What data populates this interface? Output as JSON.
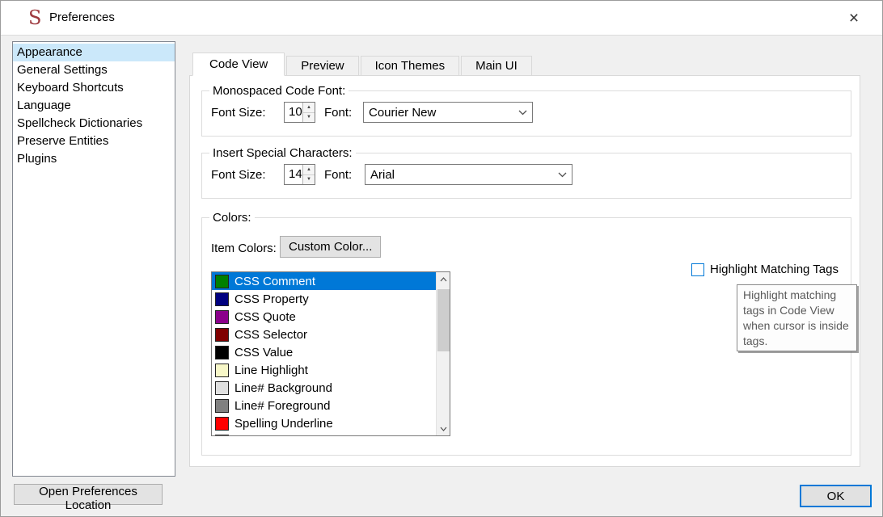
{
  "window": {
    "title": "Preferences",
    "logo_glyph": "S",
    "close_glyph": "×"
  },
  "sidebar": {
    "items": [
      {
        "label": "Appearance",
        "selected": true
      },
      {
        "label": "General Settings",
        "selected": false
      },
      {
        "label": "Keyboard Shortcuts",
        "selected": false
      },
      {
        "label": "Language",
        "selected": false
      },
      {
        "label": "Spellcheck Dictionaries",
        "selected": false
      },
      {
        "label": "Preserve Entities",
        "selected": false
      },
      {
        "label": "Plugins",
        "selected": false
      }
    ]
  },
  "tabs": [
    {
      "label": "Code View",
      "active": true
    },
    {
      "label": "Preview",
      "active": false
    },
    {
      "label": "Icon Themes",
      "active": false
    },
    {
      "label": "Main UI",
      "active": false
    }
  ],
  "code_view_tab": {
    "monospaced_group": {
      "title": "Monospaced Code Font:",
      "font_size_label": "Font Size:",
      "font_size_value": "10",
      "font_label": "Font:",
      "font_value": "Courier New"
    },
    "special_chars_group": {
      "title": "Insert Special Characters:",
      "font_size_label": "Font Size:",
      "font_size_value": "14",
      "font_label": "Font:",
      "font_value": "Arial"
    },
    "colors_group": {
      "title": "Colors:",
      "item_colors_label": "Item Colors:",
      "custom_color_button_label": "Custom Color...",
      "color_items": [
        {
          "label": "CSS Comment",
          "color": "#008000",
          "selected": true
        },
        {
          "label": "CSS Property",
          "color": "#000080",
          "selected": false
        },
        {
          "label": "CSS Quote",
          "color": "#8b008b",
          "selected": false
        },
        {
          "label": "CSS Selector",
          "color": "#800000",
          "selected": false
        },
        {
          "label": "CSS Value",
          "color": "#000000",
          "selected": false
        },
        {
          "label": "Line Highlight",
          "color": "#f7f7c8",
          "selected": false
        },
        {
          "label": "Line# Background",
          "color": "#e0e0e0",
          "selected": false
        },
        {
          "label": "Line# Foreground",
          "color": "#808080",
          "selected": false
        },
        {
          "label": "Spelling Underline",
          "color": "#ff0000",
          "selected": false
        },
        {
          "label": "",
          "color": "#7a0000",
          "selected": false
        }
      ],
      "highlight_matching_tags": {
        "label": "Highlight Matching Tags",
        "checked": false
      },
      "tooltip_text": "Highlight matching tags in Code View when cursor is inside tags."
    }
  },
  "footer": {
    "open_preferences_location_label": "Open Preferences Location",
    "ok_label": "OK"
  },
  "colors": {
    "accent": "#0078d7",
    "list_selection_bg": "#0078d7",
    "sidebar_selection_bg": "#cbe8fa",
    "window_bg": "#f0f0f0",
    "pane_bg": "#ffffff",
    "logo_color": "#9e3a3f"
  }
}
